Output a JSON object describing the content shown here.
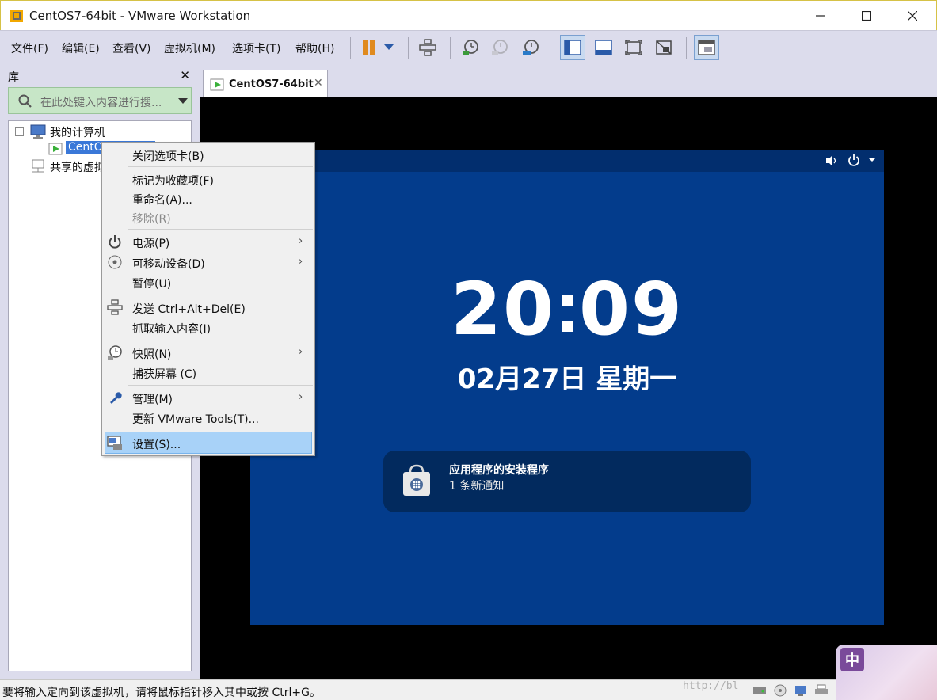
{
  "window": {
    "title": "CentOS7-64bit - VMware Workstation"
  },
  "menu": [
    "文件(F)",
    "编辑(E)",
    "查看(V)",
    "虚拟机(M)",
    "选项卡(T)",
    "帮助(H)"
  ],
  "library": {
    "title": "库",
    "search_placeholder": "在此处键入内容进行搜...",
    "tree": {
      "root": "我的计算机",
      "vm": "CentO",
      "shared": "共享的虚拟"
    }
  },
  "tab": {
    "label": "CentOS7-64bit"
  },
  "guest": {
    "clock_hh": "20",
    "clock_mm": "09",
    "date": "02月27日 星期一",
    "notif_title": "应用程序的安装程序",
    "notif_body": "1 条新通知"
  },
  "context_menu": {
    "close_tab": "关闭选项卡(B)",
    "mark_favorite": "标记为收藏项(F)",
    "rename": "重命名(A)...",
    "remove": "移除(R)",
    "power": "电源(P)",
    "removable": "可移动设备(D)",
    "pause": "暂停(U)",
    "send_cad": "发送 Ctrl+Alt+Del(E)",
    "grab_input": "抓取输入内容(I)",
    "snapshot": "快照(N)",
    "capture_screen": "捕获屏幕 (C)",
    "manage": "管理(M)",
    "update_tools": "更新 VMware Tools(T)...",
    "settings": "设置(S)..."
  },
  "statusbar": {
    "message": "要将输入定向到该虚拟机，请将鼠标指针移入其中或按 Ctrl+G。",
    "watermark": "http://bl"
  },
  "ime": {
    "label": "中"
  },
  "colors": {
    "guest_bg": "#033c8c",
    "highlight": "#a8d2f8",
    "library_bg": "#dcdcec"
  }
}
